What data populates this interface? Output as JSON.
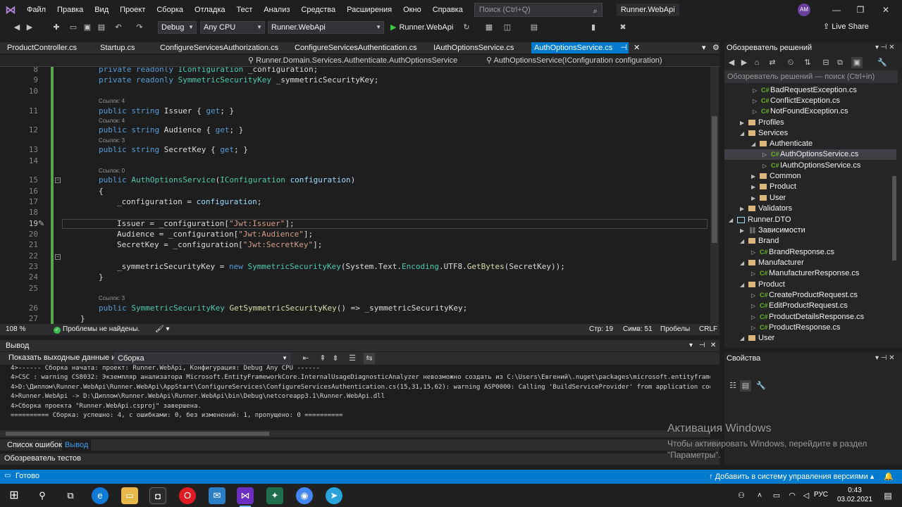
{
  "menu": {
    "items": [
      "Файл",
      "Правка",
      "Вид",
      "Проект",
      "Сборка",
      "Отладка",
      "Тест",
      "Анализ",
      "Средства",
      "Расширения",
      "Окно",
      "Справка"
    ],
    "search_placeholder": "Поиск (Ctrl+Q)",
    "project_title": "Runner.WebApi",
    "user_initials": "AM"
  },
  "toolbar": {
    "configuration": "Debug",
    "platform": "Any CPU",
    "startup_project": "Runner.WebApi",
    "run_label": "Runner.WebApi",
    "live_share": "Live Share"
  },
  "doc_tabs": [
    {
      "label": "ProductController.cs"
    },
    {
      "label": "Startup.cs"
    },
    {
      "label": "ConfigureServicesAuthorization.cs"
    },
    {
      "label": "ConfigureServicesAuthentication.cs"
    },
    {
      "label": "IAuthOptionsService.cs"
    },
    {
      "label": "AuthOptionsService.cs"
    }
  ],
  "navbar": {
    "type": "Runner.Domain.Services.Authenticate.AuthOptionsService",
    "member": "AuthOptionsService(IConfiguration configuration)"
  },
  "editor": {
    "line_numbers": [
      "8",
      "9",
      "10",
      "11",
      "12",
      "13",
      "14",
      "15",
      "16",
      "17",
      "18",
      "19",
      "20",
      "21",
      "22",
      "23",
      "24",
      "25",
      "26",
      "27"
    ],
    "codelens": [
      "Ссылок: 4",
      "Ссылок: 4",
      "Ссылок: 3",
      "Ссылок: 0",
      "Ссылок: 3"
    ],
    "strings": [
      "\"Jwt:Issuer\"",
      "\"Jwt:Audience\"",
      "\"Jwt:SecretKey\""
    ]
  },
  "editor_status": {
    "zoom": "108 %",
    "problems": "Проблемы не найдены.",
    "line": "Стр: 19",
    "column": "Симв: 51",
    "whitespace": "Пробелы",
    "line_ending": "CRLF"
  },
  "output": {
    "title": "Вывод",
    "source_label": "Показать выходные данные из:",
    "source_value": "Сборка",
    "lines": [
      "4>------ Сборка начата: проект: Runner.WebApi, Конфигурация: Debug Any CPU ------",
      "4>CSC : warning CS8032: Экземпляр анализатора Microsoft.EntityFrameworkCore.InternalUsageDiagnosticAnalyzer невозможно создать из C:\\Users\\Евгений\\.nuget\\packages\\microsoft.entityframewo",
      "4>D:\\Диплом\\Runner.WebApi\\Runner.WebApi\\AppStart\\ConfigureServices\\ConfigureServicesAuthentication.cs(15,31,15,62): warning ASP0000: Calling 'BuildServiceProvider' from application code",
      "4>Runner.WebApi -> D:\\Диплом\\Runner.WebApi\\Runner.WebApi\\bin\\Debug\\netcoreapp3.1\\Runner.WebApi.dll",
      "4>Сборка проекта \"Runner.WebApi.csproj\" завершена.",
      "========== Сборка: успешно: 4, с ошибками: 0, без изменений: 1, пропущено: 0 =========="
    ]
  },
  "bottom_tabs": [
    "Список ошибок",
    "Вывод"
  ],
  "test_explorer": "Обозреватель тестов",
  "solution_explorer": {
    "title": "Обозреватель решений",
    "search_placeholder": "Обозреватель решений — поиск (Ctrl+in)",
    "items": [
      {
        "label": "BadRequestException.cs",
        "kind": "cs"
      },
      {
        "label": "ConflictException.cs",
        "kind": "cs"
      },
      {
        "label": "NotFoundException.cs",
        "kind": "cs"
      },
      {
        "label": "Profiles",
        "kind": "folder"
      },
      {
        "label": "Services",
        "kind": "folder"
      },
      {
        "label": "Authenticate",
        "kind": "folder"
      },
      {
        "label": "AuthOptionsService.cs",
        "kind": "cs"
      },
      {
        "label": "IAuthOptionsService.cs",
        "kind": "cs"
      },
      {
        "label": "Common",
        "kind": "folder"
      },
      {
        "label": "Product",
        "kind": "folder"
      },
      {
        "label": "User",
        "kind": "folder"
      },
      {
        "label": "Validators",
        "kind": "folder"
      },
      {
        "label": "Runner.DTO",
        "kind": "project"
      },
      {
        "label": "Зависимости",
        "kind": "dependencies"
      },
      {
        "label": "Brand",
        "kind": "folder"
      },
      {
        "label": "BrandResponse.cs",
        "kind": "cs"
      },
      {
        "label": "Manufacturer",
        "kind": "folder"
      },
      {
        "label": "ManufacturerResponse.cs",
        "kind": "cs"
      },
      {
        "label": "Product",
        "kind": "folder"
      },
      {
        "label": "CreateProductRequest.cs",
        "kind": "cs"
      },
      {
        "label": "EditProductRequest.cs",
        "kind": "cs"
      },
      {
        "label": "ProductDetailsResponse.cs",
        "kind": "cs"
      },
      {
        "label": "ProductResponse.cs",
        "kind": "cs"
      },
      {
        "label": "User",
        "kind": "folder"
      }
    ]
  },
  "properties": {
    "title": "Свойства"
  },
  "activation": {
    "title": "Активация Windows",
    "subtitle_1": "Чтобы активировать Windows, перейдите в раздел",
    "subtitle_2": "\"Параметры\"."
  },
  "statusbar": {
    "ready": "Готово",
    "source_control": "Добавить в систему управления версиями"
  },
  "taskbar": {
    "lang": "РУС",
    "time": "0:43",
    "date": "03.02.2021"
  },
  "colors": {
    "accent": "#007acc",
    "keyword": "#569cd6",
    "type": "#4ec9b0",
    "string": "#d69d85",
    "change_bar": "#57a64a"
  }
}
